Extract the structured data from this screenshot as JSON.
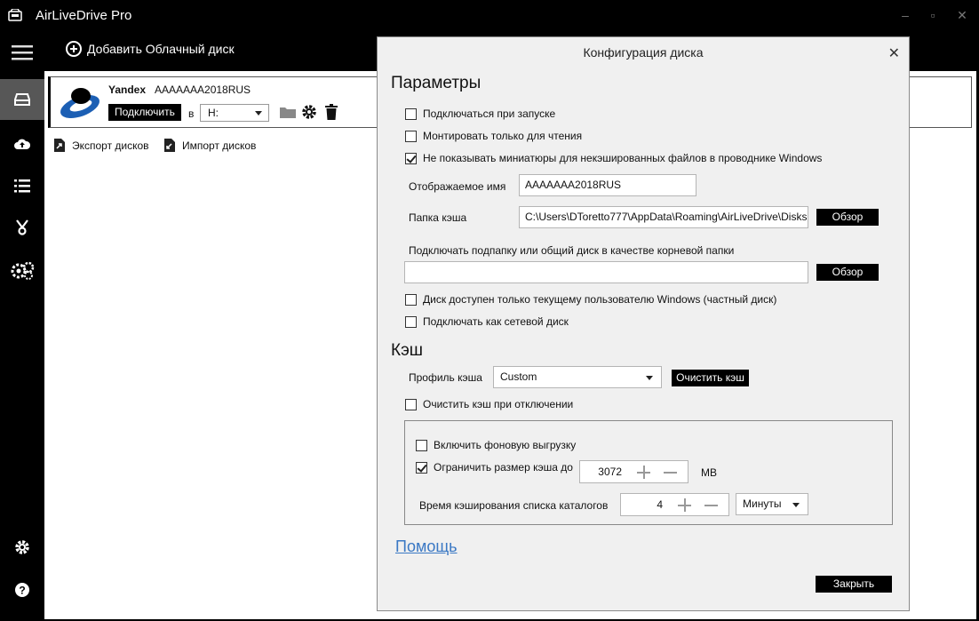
{
  "app": {
    "title": "AirLiveDrive Pro"
  },
  "window_controls": {
    "minimize": "–",
    "maximize": "▫",
    "close": "✕"
  },
  "toolbar": {
    "add_disk_label": "Добавить Облачный диск"
  },
  "sidebar": {
    "items": [
      {
        "name": "menu",
        "icon": "hamburger-icon"
      },
      {
        "name": "disks",
        "icon": "drive-icon",
        "active": true
      },
      {
        "name": "upload",
        "icon": "cloud-upload-icon"
      },
      {
        "name": "list",
        "icon": "list-icon"
      },
      {
        "name": "tools",
        "icon": "tools-icon"
      },
      {
        "name": "services",
        "icon": "gears-icon"
      },
      {
        "name": "settings",
        "icon": "gear-icon"
      },
      {
        "name": "help",
        "icon": "help-icon"
      }
    ]
  },
  "disk": {
    "provider": "Yandex",
    "name": "AAAAAAA2018RUS",
    "connect_label": "Подключить",
    "in_label": "в",
    "drive_letter": "H:"
  },
  "list_actions": {
    "export_label": "Экспорт дисков",
    "import_label": "Импорт дисков"
  },
  "dialog": {
    "title": "Конфигурация диска",
    "close": "✕",
    "params_title": "Параметры",
    "connect_on_start": "Подключаться при запуске",
    "mount_readonly": "Монтировать только для чтения",
    "no_thumbnails": "Не показывать миниатюры для некэшированных файлов в проводнике Windows",
    "display_name_label": "Отображаемое имя",
    "display_name_value": "AAAAAAA2018RUS",
    "cache_folder_label": "Папка кэша",
    "cache_folder_value": "C:\\Users\\DToretto777\\AppData\\Roaming\\AirLiveDrive\\Disks",
    "browse_label": "Обзор",
    "subfolder_label": "Подключать подпапку или общий диск в качестве корневой папки",
    "subfolder_value": "",
    "private_disk": "Диск доступен только текущему пользователю Windows (частный диск)",
    "network_drive": "Подключать как сетевой диск",
    "cache_title": "Кэш",
    "cache_profile_label": "Профиль кэша",
    "cache_profile_value": "Custom",
    "clear_cache_label": "Очистить кэш",
    "clear_on_disconnect": "Очистить кэш при отключении",
    "background_upload": "Включить фоновую выгрузку",
    "limit_cache_size": "Ограничить размер кэша до",
    "cache_size_value": "3072",
    "cache_size_unit": "MB",
    "dir_cache_time_label": "Время кэширования списка каталогов",
    "dir_cache_time_value": "4",
    "dir_cache_time_unit": "Минуты",
    "help_label": "Помощь",
    "close_label": "Закрыть",
    "checked": {
      "connect_on_start": false,
      "mount_readonly": false,
      "no_thumbnails": true,
      "private_disk": false,
      "network_drive": false,
      "clear_on_disconnect": false,
      "background_upload": false,
      "limit_cache_size": true
    }
  }
}
